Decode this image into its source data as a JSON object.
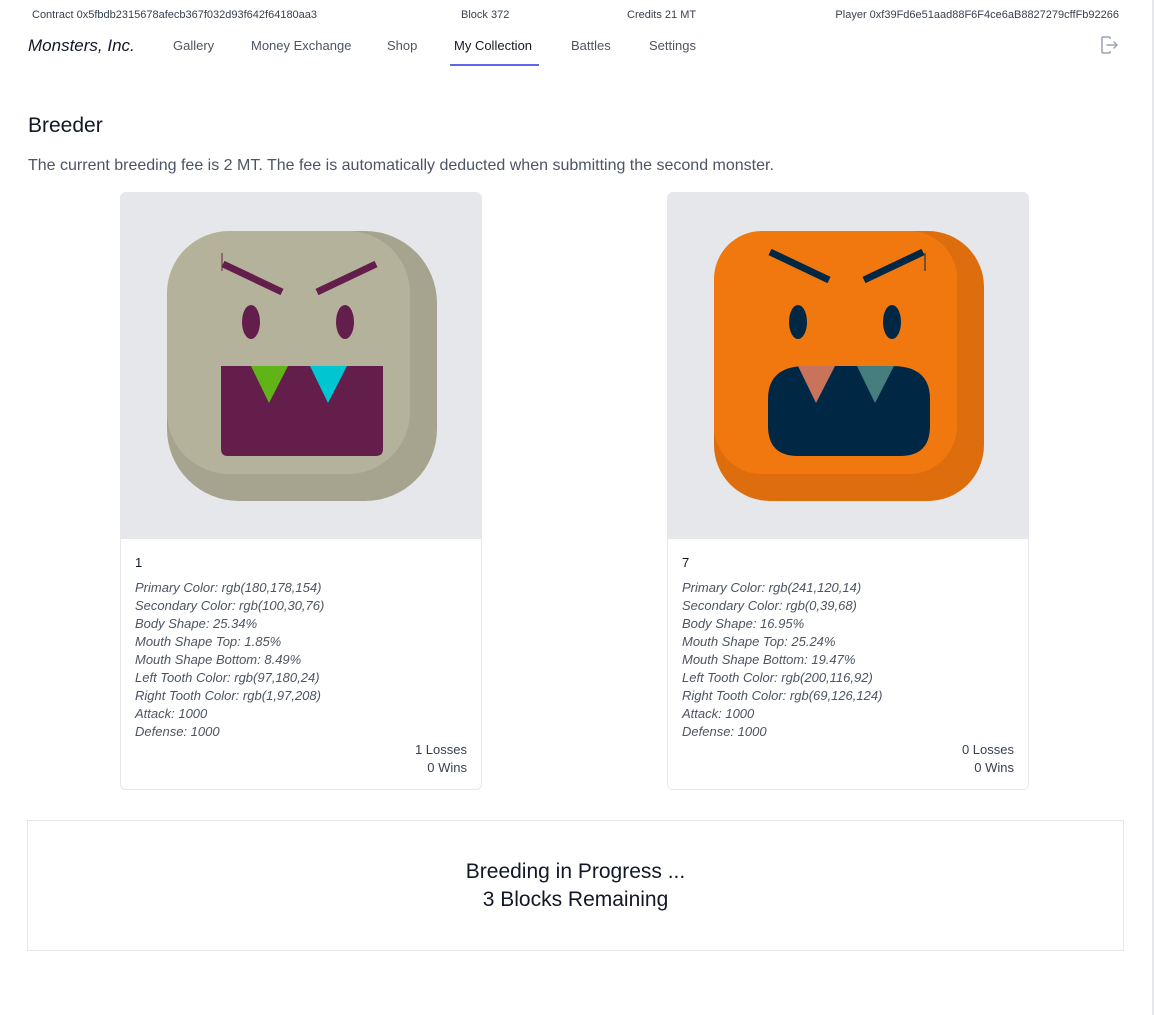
{
  "topbar": {
    "contract": "Contract 0x5fbdb2315678afecb367f032d93f642f64180aa3",
    "block": "Block 372",
    "credits": "Credits 21 MT",
    "player": "Player 0xf39Fd6e51aad88F6F4ce6aB8827279cffFb92266"
  },
  "nav": {
    "brand": "Monsters, Inc.",
    "items": [
      "Gallery",
      "Money Exchange",
      "Shop",
      "My Collection",
      "Battles",
      "Settings"
    ],
    "active": "My Collection",
    "logout_icon": "logout-icon"
  },
  "page": {
    "title": "Breeder",
    "fee_text": "The current breeding fee is 2 MT. The fee is automatically deducted when submitting the second monster."
  },
  "monsters": [
    {
      "id": "1",
      "colors": {
        "primary": "#b4b29a",
        "secondary": "#641e4c",
        "left_tooth": "#61b418",
        "right_tooth": "#01c5d0"
      },
      "attributes": [
        "Primary Color: rgb(180,178,154)",
        "Secondary Color: rgb(100,30,76)",
        "Body Shape: 25.34%",
        "Mouth Shape Top: 1.85%",
        "Mouth Shape Bottom: 8.49%",
        "Left Tooth Color: rgb(97,180,24)",
        "Right Tooth Color: rgb(1,97,208)",
        "Attack: 1000",
        "Defense: 1000"
      ],
      "losses": "1 Losses",
      "wins": "0 Wins"
    },
    {
      "id": "7",
      "colors": {
        "primary": "#f1780e",
        "secondary": "#002744",
        "left_tooth": "#c8745c",
        "right_tooth": "#457e7c"
      },
      "attributes": [
        "Primary Color: rgb(241,120,14)",
        "Secondary Color: rgb(0,39,68)",
        "Body Shape: 16.95%",
        "Mouth Shape Top: 25.24%",
        "Mouth Shape Bottom: 19.47%",
        "Left Tooth Color: rgb(200,116,92)",
        "Right Tooth Color: rgb(69,126,124)",
        "Attack: 1000",
        "Defense: 1000"
      ],
      "losses": "0 Losses",
      "wins": "0 Wins"
    }
  ],
  "breeding": {
    "line1": "Breeding in Progress ...",
    "line2": "3 Blocks Remaining"
  }
}
